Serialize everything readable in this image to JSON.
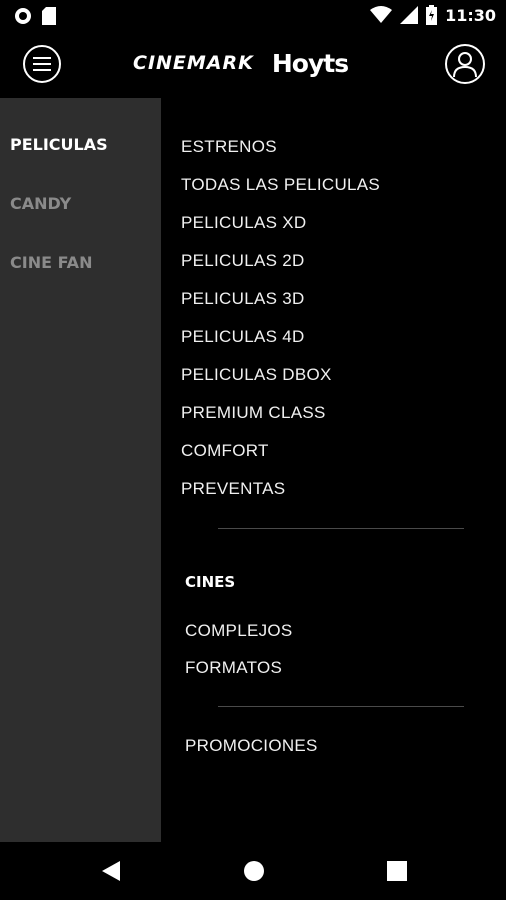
{
  "status_bar": {
    "time": "11:30",
    "icons": [
      "circle-notification-icon",
      "sd-card-icon",
      "wifi-icon",
      "cell-signal-icon",
      "battery-icon"
    ]
  },
  "app_bar": {
    "brand_left": "CINEMARK",
    "brand_right": "Hoyts",
    "menu_icon": "hamburger-menu-icon",
    "profile_icon": "user-profile-icon"
  },
  "sidebar": {
    "items": [
      {
        "label": "PELICULAS",
        "active": true
      },
      {
        "label": "CANDY",
        "active": false
      },
      {
        "label": "CINE FAN",
        "active": false
      }
    ]
  },
  "submenu": {
    "items": [
      "ESTRENOS",
      "TODAS LAS PELICULAS",
      "PELICULAS XD",
      "PELICULAS 2D",
      "PELICULAS 3D",
      "PELICULAS 4D",
      "PELICULAS DBOX",
      "PREMIUM CLASS",
      "COMFORT",
      "PREVENTAS"
    ]
  },
  "cines": {
    "heading": "CINES",
    "items": [
      "COMPLEJOS",
      "FORMATOS"
    ]
  },
  "promos": {
    "label": "PROMOCIONES"
  },
  "nav_bar": {
    "icons": [
      "back-triangle-icon",
      "home-circle-icon",
      "recents-square-icon"
    ]
  },
  "colors": {
    "background": "#000000",
    "sidebar": "#2e2e2e",
    "active_text": "#ffffff",
    "inactive_text": "#8a8a8a",
    "divider": "#4a4a4a"
  }
}
